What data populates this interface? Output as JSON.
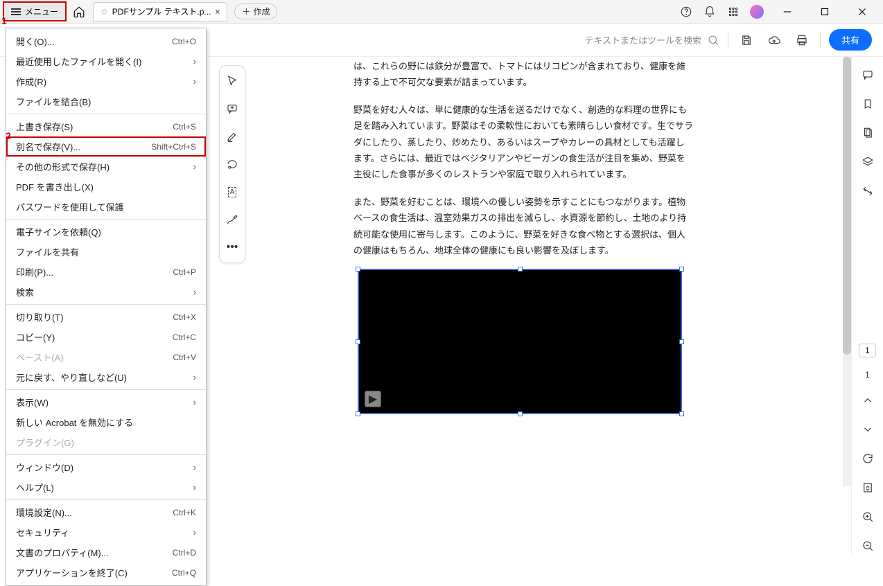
{
  "titlebar": {
    "menu_label": "メニュー",
    "tab_title": "PDFサンプル テキスト.p...",
    "new_tab_label": "作成"
  },
  "toolbar": {
    "search_placeholder": "テキストまたはツールを検索",
    "share_label": "共有"
  },
  "document": {
    "para1": "は、これらの野には鉄分が豊富で、トマトにはリコピンが含まれており、健康を維持する上で不可欠な要素が詰まっています。",
    "para2": "野菜を好む人々は、単に健康的な生活を送るだけでなく、創造的な料理の世界にも足を踏み入れています。野菜はその柔軟性においても素晴らしい食材です。生でサラダにしたり、蒸したり、炒めたり、あるいはスープやカレーの具材としても活躍します。さらには、最近ではベジタリアンやビーガンの食生活が注目を集め、野菜を主役にした食事が多くのレストランや家庭で取り入れられています。",
    "para3": "また、野菜を好むことは、環境への優しい姿勢を示すことにもつながります。植物ベースの食生活は、温室効果ガスの排出を減らし、水資源を節約し、土地のより持続可能な使用に寄与します。このように、野菜を好きな食べ物とする選択は、個人の健康はもちろん、地球全体の健康にも良い影響を及ぼします。"
  },
  "right_rail": {
    "page_badge": "1",
    "page_total": "1"
  },
  "menu": {
    "items": [
      {
        "label": "開く(O)...",
        "shortcut": "Ctrl+O"
      },
      {
        "label": "最近使用したファイルを開く(I)",
        "submenu": true
      },
      {
        "label": "作成(R)",
        "submenu": true
      },
      {
        "label": "ファイルを結合(B)"
      },
      {
        "sep": true
      },
      {
        "label": "上書き保存(S)",
        "shortcut": "Ctrl+S"
      },
      {
        "label": "別名で保存(V)...",
        "shortcut": "Shift+Ctrl+S",
        "highlight": true
      },
      {
        "label": "その他の形式で保存(H)",
        "submenu": true
      },
      {
        "label": "PDF を書き出し(X)"
      },
      {
        "label": "パスワードを使用して保護"
      },
      {
        "sep": true
      },
      {
        "label": "電子サインを依頼(Q)"
      },
      {
        "label": "ファイルを共有"
      },
      {
        "label": "印刷(P)...",
        "shortcut": "Ctrl+P"
      },
      {
        "label": "検索",
        "submenu": true
      },
      {
        "sep": true
      },
      {
        "label": "切り取り(T)",
        "shortcut": "Ctrl+X"
      },
      {
        "label": "コピー(Y)",
        "shortcut": "Ctrl+C"
      },
      {
        "label": "ペースト(A)",
        "shortcut": "Ctrl+V",
        "disabled": true
      },
      {
        "label": "元に戻す、やり直しなど(U)",
        "submenu": true
      },
      {
        "sep": true
      },
      {
        "label": "表示(W)",
        "submenu": true
      },
      {
        "label": "新しい Acrobat を無効にする"
      },
      {
        "label": "プラグイン(G)",
        "disabled": true
      },
      {
        "sep": true
      },
      {
        "label": "ウィンドウ(D)",
        "submenu": true
      },
      {
        "label": "ヘルプ(L)",
        "submenu": true
      },
      {
        "sep": true
      },
      {
        "label": "環境設定(N)...",
        "shortcut": "Ctrl+K"
      },
      {
        "label": "セキュリティ",
        "submenu": true
      },
      {
        "label": "文書のプロパティ(M)...",
        "shortcut": "Ctrl+D"
      },
      {
        "label": "アプリケーションを終了(C)",
        "shortcut": "Ctrl+Q"
      }
    ]
  },
  "callouts": {
    "one": "1",
    "two": "2"
  }
}
